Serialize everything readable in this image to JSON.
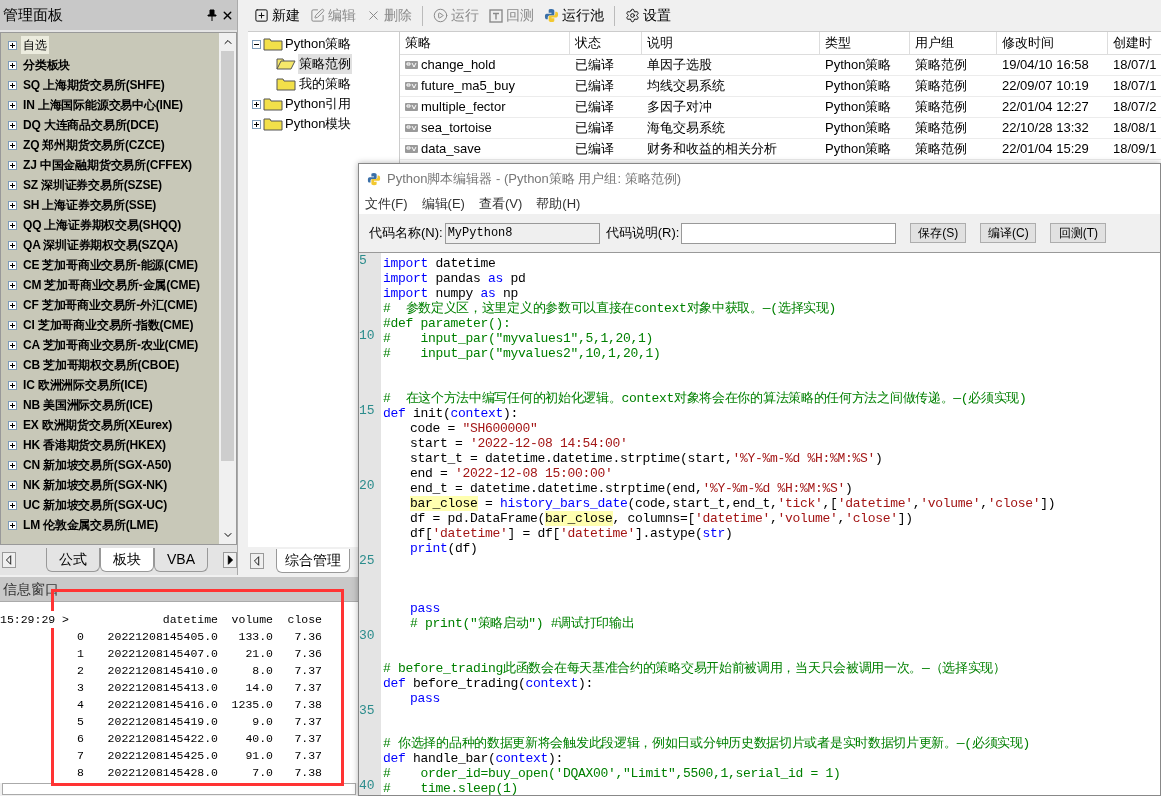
{
  "left_panel": {
    "title": "管理面板",
    "items": [
      {
        "label": "自选",
        "selected": true
      },
      {
        "label": "分类板块",
        "selected": false
      },
      {
        "label": "SQ 上海期货交易所(SHFE)",
        "selected": false
      },
      {
        "label": "IN 上海国际能源交易中心(INE)",
        "selected": false
      },
      {
        "label": "DQ 大连商品交易所(DCE)",
        "selected": false
      },
      {
        "label": "ZQ 郑州期货交易所(CZCE)",
        "selected": false
      },
      {
        "label": "ZJ 中国金融期货交易所(CFFEX)",
        "selected": false
      },
      {
        "label": "SZ 深圳证券交易所(SZSE)",
        "selected": false
      },
      {
        "label": "SH 上海证券交易所(SSE)",
        "selected": false
      },
      {
        "label": "QQ 上海证券期权交易(SHQQ)",
        "selected": false
      },
      {
        "label": "QA 深圳证券期权交易(SZQA)",
        "selected": false
      },
      {
        "label": "CE 芝加哥商业交易所-能源(CME)",
        "selected": false
      },
      {
        "label": "CM 芝加哥商业交易所-金属(CME)",
        "selected": false
      },
      {
        "label": "CF 芝加哥商业交易所-外汇(CME)",
        "selected": false
      },
      {
        "label": "CI 芝加哥商业交易所-指数(CME)",
        "selected": false
      },
      {
        "label": "CA 芝加哥商业交易所-农业(CME)",
        "selected": false
      },
      {
        "label": "CB 芝加哥期权交易所(CBOE)",
        "selected": false
      },
      {
        "label": "IC 欧洲洲际交易所(ICE)",
        "selected": false
      },
      {
        "label": "NB 美国洲际交易所(ICE)",
        "selected": false
      },
      {
        "label": "EX 欧洲期货交易所(XEurex)",
        "selected": false
      },
      {
        "label": "HK 香港期货交易所(HKEX)",
        "selected": false
      },
      {
        "label": "CN 新加坡交易所(SGX-A50)",
        "selected": false
      },
      {
        "label": "NK 新加坡交易所(SGX-NK)",
        "selected": false
      },
      {
        "label": "UC 新加坡交易所(SGX-UC)",
        "selected": false
      },
      {
        "label": "LM 伦敦金属交易所(LME)",
        "selected": false
      }
    ],
    "tabs": [
      {
        "label": "公式",
        "selected": false
      },
      {
        "label": "板块",
        "selected": true
      },
      {
        "label": "VBA",
        "selected": false
      }
    ]
  },
  "toolbar": [
    {
      "label": "新建",
      "disabled": false
    },
    {
      "label": "编辑",
      "disabled": true
    },
    {
      "label": "删除",
      "disabled": true
    },
    {
      "label": "运行",
      "disabled": true
    },
    {
      "label": "回测",
      "disabled": true
    },
    {
      "label": "运行池",
      "disabled": false
    },
    {
      "label": "设置",
      "disabled": false
    }
  ],
  "tree": [
    {
      "label": "Python策略",
      "expanded": true,
      "children": [
        {
          "label": "策略范例",
          "selected": true
        },
        {
          "label": "我的策略",
          "selected": false
        }
      ]
    },
    {
      "label": "Python引用",
      "expanded": false
    },
    {
      "label": "Python模块",
      "expanded": false
    }
  ],
  "table": {
    "columns": [
      "策略",
      "状态",
      "说明",
      "类型",
      "用户组",
      "修改时间",
      "创建时"
    ],
    "rows": [
      [
        "change_hold",
        "已编译",
        "单因子选股",
        "Python策略",
        "策略范例",
        "19/04/10 16:58",
        "18/07/1"
      ],
      [
        "future_ma5_buy",
        "已编译",
        "均线交易系统",
        "Python策略",
        "策略范例",
        "22/09/07 10:19",
        "18/07/1"
      ],
      [
        "multiple_fector",
        "已编译",
        "多因子对冲",
        "Python策略",
        "策略范例",
        "22/01/04 12:27",
        "18/07/2"
      ],
      [
        "sea_tortoise",
        "已编译",
        "海龟交易系统",
        "Python策略",
        "策略范例",
        "22/10/28 13:32",
        "18/08/1"
      ],
      [
        "data_save",
        "已编译",
        "财务和收益的相关分析",
        "Python策略",
        "策略范例",
        "22/01/04 15:29",
        "18/09/1"
      ]
    ]
  },
  "center_tabs": [
    {
      "label": "综合管理",
      "selected": true
    }
  ],
  "info_window": {
    "title": "信息窗口",
    "time": "15:29:29 >",
    "columns": [
      "",
      "datetime",
      "volume",
      "close"
    ],
    "rows": [
      [
        "0",
        "20221208145405.0",
        "133.0",
        "7.36"
      ],
      [
        "1",
        "20221208145407.0",
        "21.0",
        "7.36"
      ],
      [
        "2",
        "20221208145410.0",
        "8.0",
        "7.37"
      ],
      [
        "3",
        "20221208145413.0",
        "14.0",
        "7.37"
      ],
      [
        "4",
        "20221208145416.0",
        "1235.0",
        "7.38"
      ],
      [
        "5",
        "20221208145419.0",
        "9.0",
        "7.37"
      ],
      [
        "6",
        "20221208145422.0",
        "40.0",
        "7.37"
      ],
      [
        "7",
        "20221208145425.0",
        "91.0",
        "7.37"
      ],
      [
        "8",
        "20221208145428.0",
        "7.0",
        "7.38"
      ]
    ]
  },
  "editor": {
    "title": "Python脚本编辑器 - (Python策略 用户组: 策略范例)",
    "menu": [
      "文件(F)",
      "编辑(E)",
      "查看(V)",
      "帮助(H)"
    ],
    "name_label": "代码名称(N):",
    "name_value": "MyPython8",
    "desc_label": "代码说明(R):",
    "buttons": [
      "保存(S)",
      "编译(C)",
      "回测(T)"
    ],
    "lines": [
      {
        "number": "5",
        "tokens": [
          {
            "kind": "kw",
            "text": "import"
          },
          {
            "kind": "plain",
            "text": " datetime"
          }
        ]
      },
      {
        "tokens": [
          {
            "kind": "kw",
            "text": "import"
          },
          {
            "kind": "plain",
            "text": " pandas "
          },
          {
            "kind": "kw",
            "text": "as"
          },
          {
            "kind": "plain",
            "text": " pd"
          }
        ]
      },
      {
        "tokens": [
          {
            "kind": "kw",
            "text": "import"
          },
          {
            "kind": "plain",
            "text": " numpy "
          },
          {
            "kind": "kw",
            "text": "as"
          },
          {
            "kind": "plain",
            "text": " np"
          }
        ]
      },
      {
        "tokens": [
          {
            "kind": "comment",
            "text": "#  参数定义区，这里定义的参数可以直接在context对象中获取。—(选择实现)"
          }
        ]
      },
      {
        "tokens": [
          {
            "kind": "comment",
            "text": "#def parameter():"
          }
        ]
      },
      {
        "number": "10",
        "tokens": [
          {
            "kind": "comment",
            "text": "#    input_par(\"myvalues1\",5,1,20,1)"
          }
        ]
      },
      {
        "tokens": [
          {
            "kind": "comment",
            "text": "#    input_par(\"myvalues2\",10,1,20,1)"
          }
        ]
      },
      {
        "blank": true
      },
      {
        "blank": true
      },
      {
        "tokens": [
          {
            "kind": "comment",
            "text": "#  在这个方法中编写任何的初始化逻辑。context对象将会在你的算法策略的任何方法之间做传递。—(必须实现)"
          }
        ]
      },
      {
        "number": "15",
        "tokens": [
          {
            "kind": "kw",
            "text": "def"
          },
          {
            "kind": "plain",
            "text": " init("
          },
          {
            "kind": "kw",
            "text": "context"
          },
          {
            "kind": "plain",
            "text": "):"
          }
        ]
      },
      {
        "indent": true,
        "tokens": [
          {
            "kind": "plain",
            "text": "code = "
          },
          {
            "kind": "str",
            "text": "\"SH600000\""
          }
        ]
      },
      {
        "indent": true,
        "tokens": [
          {
            "kind": "plain",
            "text": "start = "
          },
          {
            "kind": "str",
            "text": "'2022-12-08 14:54:00'"
          }
        ]
      },
      {
        "indent": true,
        "tokens": [
          {
            "kind": "plain",
            "text": "start_t = datetime.datetime.strptime(start,"
          },
          {
            "kind": "str",
            "text": "'%Y-%m-%d %H:%M:%S'"
          },
          {
            "kind": "plain",
            "text": ")"
          }
        ]
      },
      {
        "indent": true,
        "tokens": [
          {
            "kind": "plain",
            "text": "end = "
          },
          {
            "kind": "str",
            "text": "'2022-12-08 15:00:00'"
          }
        ]
      },
      {
        "number": "20",
        "indent": true,
        "tokens": [
          {
            "kind": "plain",
            "text": "end_t = datetime.datetime.strptime(end,"
          },
          {
            "kind": "str",
            "text": "'%Y-%m-%d %H:%M:%S'"
          },
          {
            "kind": "plain",
            "text": ")"
          }
        ]
      },
      {
        "indent": true,
        "tokens": [
          {
            "kind": "hl",
            "text": "bar_close"
          },
          {
            "kind": "plain",
            "text": " = "
          },
          {
            "kind": "kw",
            "text": "history_bars_date"
          },
          {
            "kind": "plain",
            "text": "(code,start_t,end_t,"
          },
          {
            "kind": "str",
            "text": "'tick'"
          },
          {
            "kind": "plain",
            "text": ",["
          },
          {
            "kind": "str",
            "text": "'datetime'"
          },
          {
            "kind": "plain",
            "text": ","
          },
          {
            "kind": "str",
            "text": "'volume'"
          },
          {
            "kind": "plain",
            "text": ","
          },
          {
            "kind": "str",
            "text": "'close'"
          },
          {
            "kind": "plain",
            "text": "])"
          }
        ]
      },
      {
        "indent": true,
        "tokens": [
          {
            "kind": "plain",
            "text": "df = pd.DataFrame("
          },
          {
            "kind": "hl",
            "text": "bar_close"
          },
          {
            "kind": "plain",
            "text": ", columns=["
          },
          {
            "kind": "str",
            "text": "'datetime'"
          },
          {
            "kind": "plain",
            "text": ","
          },
          {
            "kind": "str",
            "text": "'volume'"
          },
          {
            "kind": "plain",
            "text": ","
          },
          {
            "kind": "str",
            "text": "'close'"
          },
          {
            "kind": "plain",
            "text": "])"
          }
        ]
      },
      {
        "indent": true,
        "tokens": [
          {
            "kind": "plain",
            "text": "df["
          },
          {
            "kind": "str",
            "text": "'datetime'"
          },
          {
            "kind": "plain",
            "text": "] = df["
          },
          {
            "kind": "str",
            "text": "'datetime'"
          },
          {
            "kind": "plain",
            "text": "].astype("
          },
          {
            "kind": "kw",
            "text": "str"
          },
          {
            "kind": "plain",
            "text": ")"
          }
        ]
      },
      {
        "indent": true,
        "tokens": [
          {
            "kind": "kw",
            "text": "print"
          },
          {
            "kind": "plain",
            "text": "(df)"
          }
        ]
      },
      {
        "number": "25"
      },
      {
        "blank": true
      },
      {
        "blank": true
      },
      {
        "indent": true,
        "tokens": [
          {
            "kind": "kw",
            "text": "pass"
          }
        ]
      },
      {
        "indent": true,
        "tokens": [
          {
            "kind": "comment",
            "text": "# print(\"策略启动\") #调试打印输出"
          }
        ]
      },
      {
        "number": "30"
      },
      {
        "blank": true
      },
      {
        "tokens": [
          {
            "kind": "comment",
            "text": "# before_trading此函数会在每天基准合约的策略交易开始前被调用，当天只会被调用一次。—（选择实现）"
          }
        ]
      },
      {
        "tokens": [
          {
            "kind": "kw",
            "text": "def"
          },
          {
            "kind": "plain",
            "text": " before_trading("
          },
          {
            "kind": "kw",
            "text": "context"
          },
          {
            "kind": "plain",
            "text": "):"
          }
        ]
      },
      {
        "indent": true,
        "tokens": [
          {
            "kind": "kw",
            "text": "pass"
          }
        ]
      },
      {
        "number": "35"
      },
      {
        "blank": true
      },
      {
        "tokens": [
          {
            "kind": "comment",
            "text": "# 你选择的品种的数据更新将会触发此段逻辑，例如日或分钟历史数据切片或者是实时数据切片更新。—(必须实现)"
          }
        ]
      },
      {
        "tokens": [
          {
            "kind": "kw",
            "text": "def"
          },
          {
            "kind": "plain",
            "text": " handle_bar("
          },
          {
            "kind": "kw",
            "text": "context"
          },
          {
            "kind": "plain",
            "text": "):"
          }
        ]
      },
      {
        "tokens": [
          {
            "kind": "comment",
            "text": "#    order_id=buy_open('DQAX00',\"Limit\",5500,1,serial_id = 1)"
          }
        ]
      },
      {
        "number": "40",
        "tokens": [
          {
            "kind": "comment",
            "text": "#    time.sleep(1)"
          }
        ]
      }
    ]
  }
}
